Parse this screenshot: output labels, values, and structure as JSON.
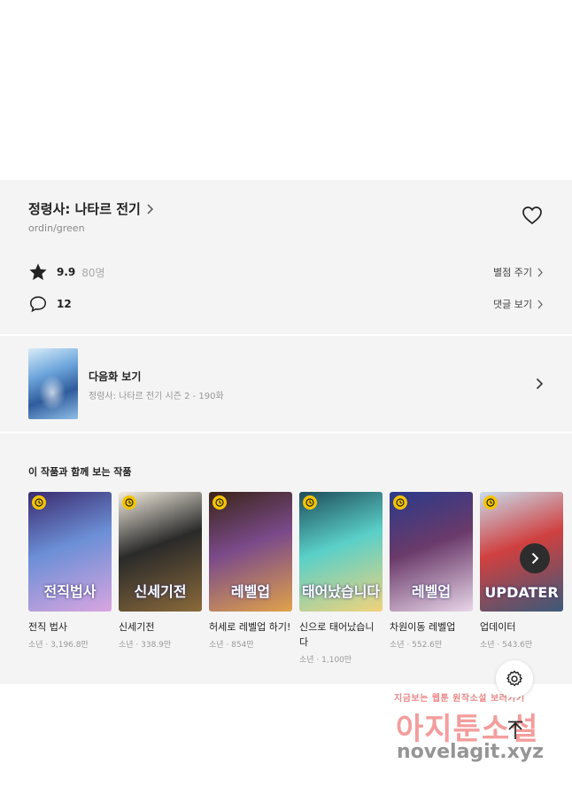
{
  "series": {
    "title": "정령사: 나타르 전기",
    "author": "ordin/green",
    "rating": "9.9",
    "rating_count": "80명",
    "rate_action": "별점 주기",
    "comment_count": "12",
    "comment_action": "댓글 보기"
  },
  "next_episode": {
    "label": "다음화 보기",
    "subtitle": "정령사: 나타르 전기 시즌 2 - 190화"
  },
  "recommendations": {
    "title": "이 작품과 함께 보는 작품",
    "items": [
      {
        "name": "전직 법사",
        "meta": "소년 · 3,196.8만",
        "cover_text": "전직법사",
        "c1": "#3b2a6e",
        "c2": "#d9a5e0",
        "c3": "#6b8fd6"
      },
      {
        "name": "신세기전",
        "meta": "소년 · 338.9만",
        "cover_text": "신세기전",
        "c1": "#f3ede0",
        "c2": "#8a6a3a",
        "c3": "#2a2a2a"
      },
      {
        "name": "허세로 레벨업 하기!",
        "meta": "소년 · 854만",
        "cover_text": "레벨업",
        "c1": "#3a2418",
        "c2": "#e0a24a",
        "c3": "#7a4a8a"
      },
      {
        "name": "신으로 태어났습니다",
        "meta": "소년 · 1,100만",
        "cover_text": "태어났습니다",
        "c1": "#1e4c5a",
        "c2": "#f2d27a",
        "c3": "#5ad0c8"
      },
      {
        "name": "차원이동 레벨업",
        "meta": "소년 · 552.6만",
        "cover_text": "레벨업",
        "c1": "#2a3a8a",
        "c2": "#e8d6e8",
        "c3": "#6a3a6a"
      },
      {
        "name": "업데이터",
        "meta": "소년 · 543.6만",
        "cover_text": "UPDATER",
        "c1": "#c8dcec",
        "c2": "#3a5a7a",
        "c3": "#d04040"
      }
    ]
  },
  "watermark": {
    "line1": "지금보는 웹툰 원작소설 보러가기",
    "line2": "아지툰소설",
    "line3": "novelagit.xyz"
  },
  "icons": [
    "chevron-right-icon",
    "heart-icon",
    "star-icon",
    "comment-icon",
    "clock-icon",
    "gear-icon",
    "arrow-up-icon"
  ]
}
